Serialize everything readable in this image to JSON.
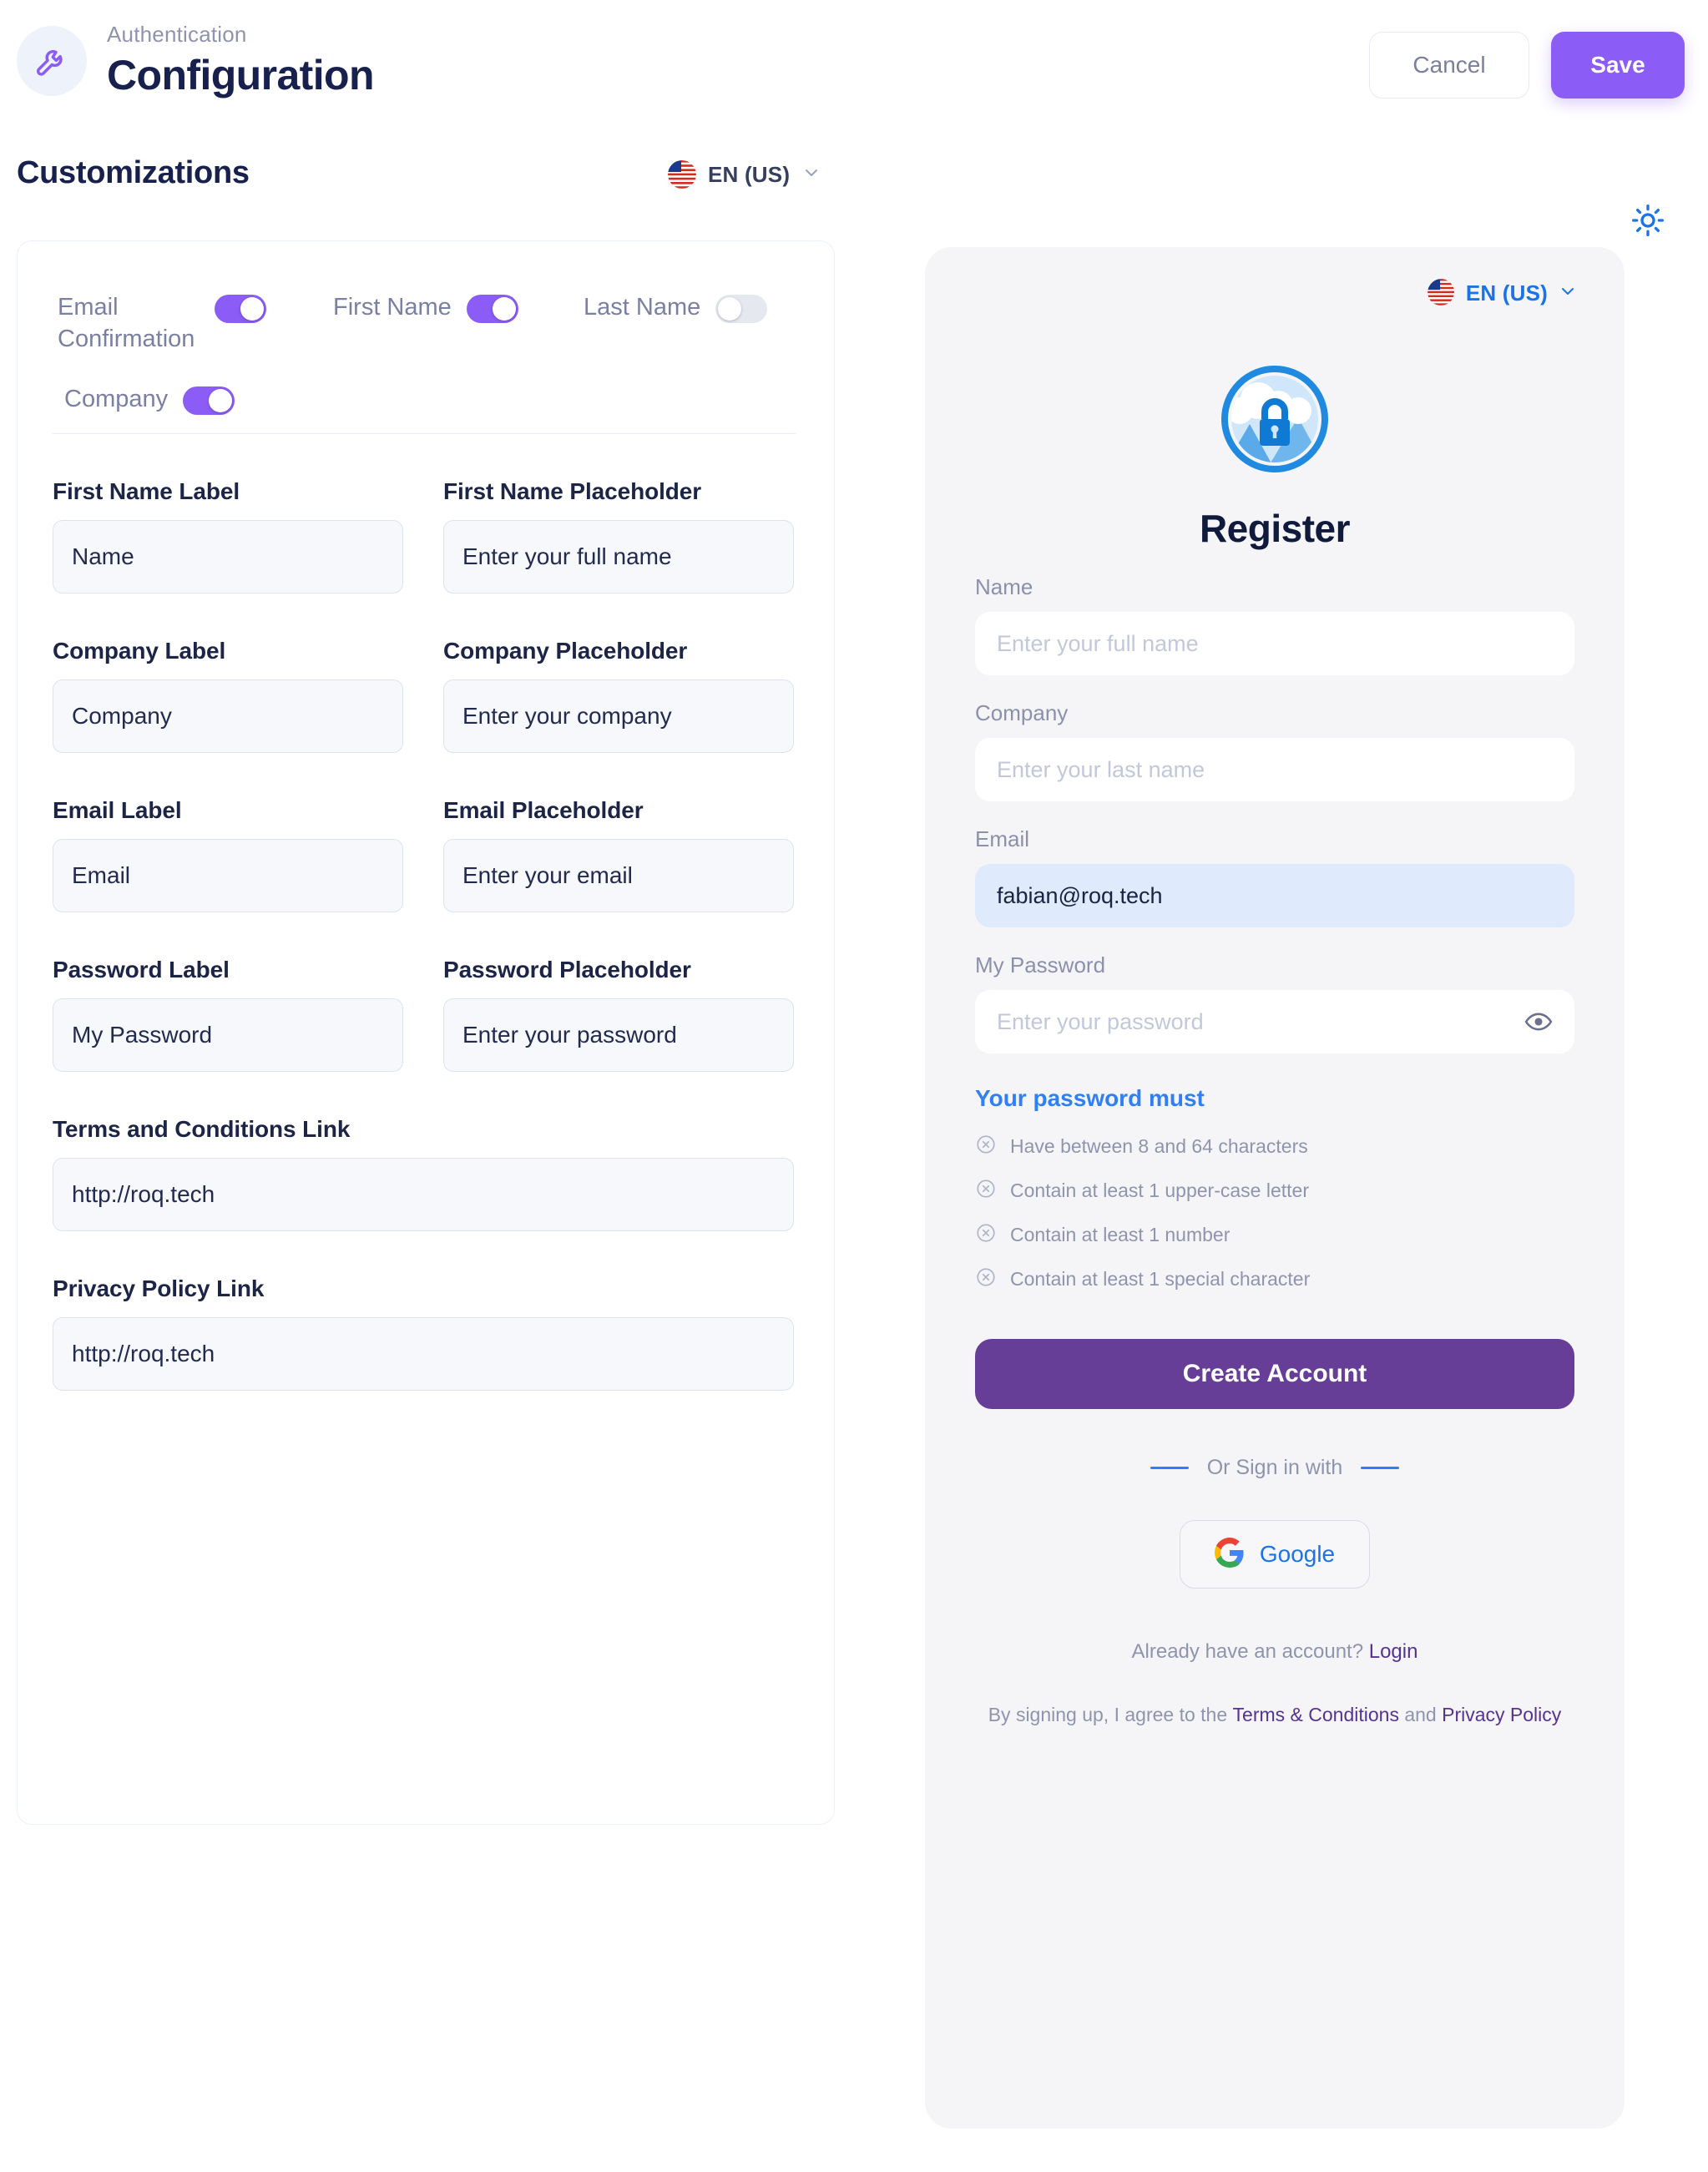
{
  "header": {
    "eyebrow": "Authentication",
    "title": "Configuration",
    "wrench_icon": "wrench-icon",
    "cancel_label": "Cancel",
    "save_label": "Save",
    "accent_purple": "#8b5cf6",
    "title_color": "#18214d"
  },
  "subheader": {
    "title": "Customizations",
    "language": "EN (US)",
    "flag_icon": "us-flag-icon",
    "chevron_icon": "chevron-down-icon",
    "theme_icon": "sun-icon",
    "theme_icon_color": "#1a73e8"
  },
  "customizations": {
    "toggles": [
      {
        "label": "Email Confirmation",
        "state": "on"
      },
      {
        "label": "First Name",
        "state": "on"
      },
      {
        "label": "Last Name",
        "state": "off"
      },
      {
        "label": "Company",
        "state": "on"
      }
    ],
    "fields": [
      {
        "label": "First Name Label",
        "value": "Name"
      },
      {
        "label": "First Name Placeholder",
        "value": "Enter your full name"
      },
      {
        "label": "Company Label",
        "value": "Company"
      },
      {
        "label": "Company Placeholder",
        "value": "Enter your company"
      },
      {
        "label": "Email Label",
        "value": "Email"
      },
      {
        "label": "Email Placeholder",
        "value": "Enter your email"
      },
      {
        "label": "Password Label",
        "value": "My Password"
      },
      {
        "label": "Password Placeholder",
        "value": "Enter your password"
      }
    ],
    "links": [
      {
        "label": "Terms and Conditions Link",
        "value": "http://roq.tech"
      },
      {
        "label": "Privacy Policy Link",
        "value": "http://roq.tech"
      }
    ]
  },
  "preview": {
    "language": "EN (US)",
    "flag_icon": "us-flag-icon",
    "chevron_icon": "chevron-down-icon",
    "logo_icon": "lock-landscape-logo",
    "title": "Register",
    "fields": [
      {
        "label": "Name",
        "placeholder": "Enter your full name",
        "value": ""
      },
      {
        "label": "Company",
        "placeholder": "Enter your last name",
        "value": ""
      },
      {
        "label": "Email",
        "placeholder": "Enter your email",
        "value": "fabian@roq.tech",
        "filled": true
      },
      {
        "label": "My Password",
        "placeholder": "Enter your password",
        "value": "",
        "eye_icon": "eye-icon"
      }
    ],
    "password_rules_title": "Your password must",
    "password_rules": [
      "Have between 8 and 64 characters",
      "Contain at least 1 upper-case letter",
      "Contain at least 1 number",
      "Contain at least 1 special character"
    ],
    "rule_icon": "circle-x-icon",
    "create_account_label": "Create Account",
    "create_account_color": "#663e98",
    "or_text": "Or Sign in with",
    "google_label": "Google",
    "google_icon": "google-icon",
    "login_prompt": "Already have an account?",
    "login_label": "Login",
    "legal_prefix": "By signing up, I agree to the",
    "legal_terms": "Terms & Conditions",
    "legal_and": "and",
    "legal_privacy": "Privacy Policy",
    "link_color": "#563391",
    "accent_blue": "#2f80f7"
  }
}
